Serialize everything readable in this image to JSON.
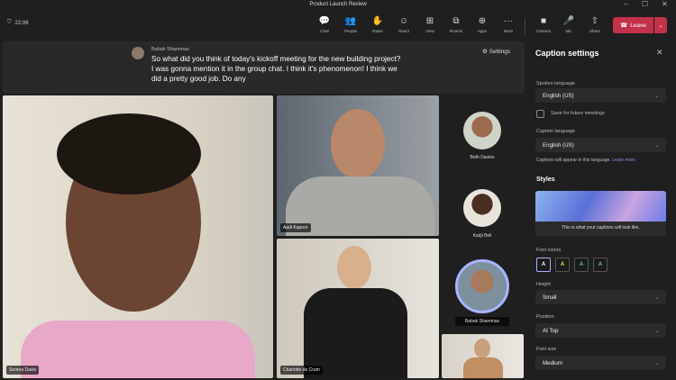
{
  "window": {
    "title": "Product Launch Review",
    "minimize": "–",
    "maximize": "☐",
    "close": "✕"
  },
  "timer": "22:06",
  "toolbar": [
    {
      "label": "Chat",
      "icon": "💬"
    },
    {
      "label": "People",
      "icon": "👥"
    },
    {
      "label": "Raise",
      "icon": "✋"
    },
    {
      "label": "React",
      "icon": "☺"
    },
    {
      "label": "View",
      "icon": "⊞"
    },
    {
      "label": "Rooms",
      "icon": "⧉"
    },
    {
      "label": "Apps",
      "icon": "⊕"
    },
    {
      "label": "More",
      "icon": "···"
    },
    {
      "label": "Camera",
      "icon": "■"
    },
    {
      "label": "Mic",
      "icon": "🎤"
    },
    {
      "label": "Share",
      "icon": "⇧"
    }
  ],
  "leave": {
    "label": "Leave",
    "color": "#c4314b"
  },
  "caption": {
    "speaker": "Babak Shammas",
    "text": "So what did you think of today's kickoff meeting for the new building project? I was gonna mention it in the group chat. I think it's phenomenon! I think we did a pretty good job. Do any",
    "settings": "Settings"
  },
  "participants": {
    "main": "Serena Davis",
    "top": "Aadi Kapoor",
    "bottom": "Charlotte de Crum",
    "side": [
      "Beth Davies",
      "Kadji Bell",
      "Babak Shammas"
    ]
  },
  "panel": {
    "title": "Caption settings",
    "spoken_label": "Spoken language",
    "spoken_value": "English (US)",
    "save_label": "Save for future meetings",
    "caption_label": "Caption language",
    "caption_value": "English (US)",
    "caption_hint": "Captions will appear in this language.",
    "learn_more": "Learn more",
    "styles": "Styles",
    "preview_text": "This is what your captions will look like.",
    "font_colors_label": "Font colors",
    "font_colors": [
      {
        "letter": "A",
        "color": "#ffffff"
      },
      {
        "letter": "A",
        "color": "#e6e65a"
      },
      {
        "letter": "A",
        "color": "#4fc3d9"
      },
      {
        "letter": "A",
        "color": "#6ad56a"
      }
    ],
    "height_label": "Height",
    "height_value": "Small",
    "position_label": "Position",
    "position_value": "At Top",
    "font_size_label": "Font size",
    "font_size_value": "Medium"
  }
}
